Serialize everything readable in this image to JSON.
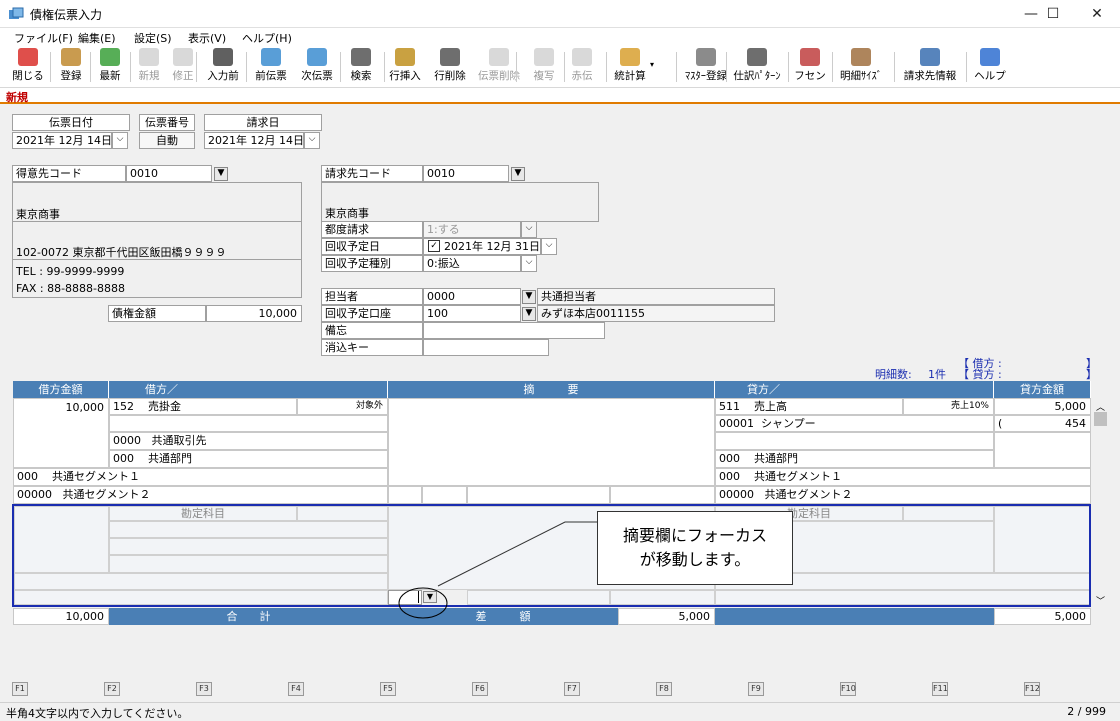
{
  "window": {
    "title": "債権伝票入力",
    "min": "—",
    "max": "☐",
    "close": "✕"
  },
  "menu": [
    "ファイル(F)",
    "編集(E)",
    "設定(S)",
    "表示(V)",
    "ヘルプ(H)"
  ],
  "toolbar": [
    {
      "label": "閉じる",
      "icon": "close-icon",
      "color": "#d9302c",
      "disabled": false
    },
    {
      "label": "登録",
      "icon": "register-icon",
      "color": "#c08a30",
      "disabled": false
    },
    {
      "label": "最新",
      "icon": "refresh-icon",
      "color": "#3aa03a",
      "disabled": false
    },
    {
      "label": "新規",
      "icon": "new-icon",
      "color": "#aaaaaa",
      "disabled": true
    },
    {
      "label": "修正",
      "icon": "edit-icon",
      "color": "#aaaaaa",
      "disabled": true
    },
    {
      "label": "入力前",
      "icon": "undo-icon",
      "color": "#444444",
      "disabled": false
    },
    {
      "label": "前伝票",
      "icon": "prev-slip-icon",
      "color": "#3c8dd0",
      "disabled": false
    },
    {
      "label": "次伝票",
      "icon": "next-slip-icon",
      "color": "#3c8dd0",
      "disabled": false
    },
    {
      "label": "検索",
      "icon": "search-icon",
      "color": "#555555",
      "disabled": false
    },
    {
      "label": "行挿入",
      "icon": "row-insert-icon",
      "color": "#c09020",
      "disabled": false
    },
    {
      "label": "行削除",
      "icon": "row-delete-icon",
      "color": "#555555",
      "disabled": false
    },
    {
      "label": "伝票削除",
      "icon": "slip-delete-icon",
      "color": "#aaaaaa",
      "disabled": true
    },
    {
      "label": "複写",
      "icon": "copy-icon",
      "color": "#aaaaaa",
      "disabled": true
    },
    {
      "label": "赤伝",
      "icon": "red-slip-icon",
      "color": "#aaaaaa",
      "disabled": true
    },
    {
      "label": "統計算",
      "icon": "stats-icon",
      "color": "#d8a030",
      "disabled": false
    },
    {
      "label": "ﾏｽﾀｰ登録",
      "icon": "master-icon",
      "color": "#777777",
      "disabled": false
    },
    {
      "label": "仕訳ﾊﾟﾀｰﾝ",
      "icon": "pattern-icon",
      "color": "#555555",
      "disabled": false
    },
    {
      "label": "フセン",
      "icon": "sticky-icon",
      "color": "#c04040",
      "disabled": false
    },
    {
      "label": "明細ｻｲｽﾞ",
      "icon": "detail-size-icon",
      "color": "#a07040",
      "disabled": false
    },
    {
      "label": "請求先情報",
      "icon": "billing-info-icon",
      "color": "#3a6fb0",
      "disabled": false
    },
    {
      "label": "ヘルプ",
      "icon": "help-icon",
      "color": "#2f6fd0",
      "disabled": false
    }
  ],
  "mode": "新規",
  "header": {
    "slip_date_label": "伝票日付",
    "slip_date": "2021年 12月 14日",
    "slip_no_label": "伝票番号",
    "slip_no": "自動",
    "billing_date_label": "請求日",
    "billing_date": "2021年 12月 14日"
  },
  "customer": {
    "code_label": "得意先コード",
    "code": "0010",
    "name": "東京商事",
    "address": "102-0072 東京都千代田区飯田橋９９９９",
    "tel": "TEL : 99-9999-9999",
    "fax": "FAX : 88-8888-8888",
    "amount_label": "債権金額",
    "amount": "10,000"
  },
  "billing": {
    "code_label": "請求先コード",
    "code": "0010",
    "name": "東京商事",
    "each_label": "都度請求",
    "each": "1:する",
    "due_label": "回収予定日",
    "due": "2021年 12月 31日",
    "kind_label": "回収予定種別",
    "kind": "0:振込",
    "staff_label": "担当者",
    "staff_code": "0000",
    "staff_name": "共通担当者",
    "account_label": "回収予定口座",
    "account_code": "100",
    "account_name": "みずほ本店0011155",
    "memo_label": "備忘",
    "clear_key_label": "消込キー"
  },
  "detail_info": {
    "count_label": "明細数:",
    "count": "1件",
    "debit": "【 借方 :",
    "credit": "【 貸方 :",
    "close": "】"
  },
  "grid": {
    "headers": [
      "借方金額",
      "借方／",
      "摘　　　要",
      "貸方／",
      "貸方金額"
    ],
    "debit_amount": "10,000",
    "debit_code": "152",
    "debit_name": "売掛金",
    "debit_tax": "対象外",
    "debit_partner_code": "0000",
    "debit_partner": "共通取引先",
    "debit_dept_code": "000",
    "debit_dept": "共通部門",
    "seg1_code": "000",
    "seg1": "共通セグメント１",
    "seg2_code": "00000",
    "seg2": "共通セグメント２",
    "credit_code": "511",
    "credit_name": "売上高",
    "credit_tax": "売上10%",
    "credit_amount": "5,000",
    "credit_sub_code": "00001",
    "credit_sub": "シャンプー",
    "credit_paren": "(",
    "credit_tax_amount": "454",
    "credit_dept_code": "000",
    "credit_dept": "共通部門",
    "cseg1_code": "000",
    "cseg1": "共通セグメント１",
    "cseg2_code": "00000",
    "cseg2": "共通セグメント２",
    "account_placeholder": "勘定科目",
    "credit_account_placeholder": "勘定科目"
  },
  "totals": {
    "debit_total": "10,000",
    "total_label": "合　　計",
    "diff_label": "差　　　額",
    "diff": "5,000",
    "credit_total": "5,000"
  },
  "callout": {
    "line1": "摘要欄にフォーカス",
    "line2": "が移動します。"
  },
  "fkeys": [
    "F1",
    "F2",
    "F3",
    "F4",
    "F5",
    "F6",
    "F7",
    "F8",
    "F9",
    "F10",
    "F11",
    "F12"
  ],
  "status": {
    "message": "半角4文字以内で入力してください。",
    "page": "2 / 999"
  }
}
